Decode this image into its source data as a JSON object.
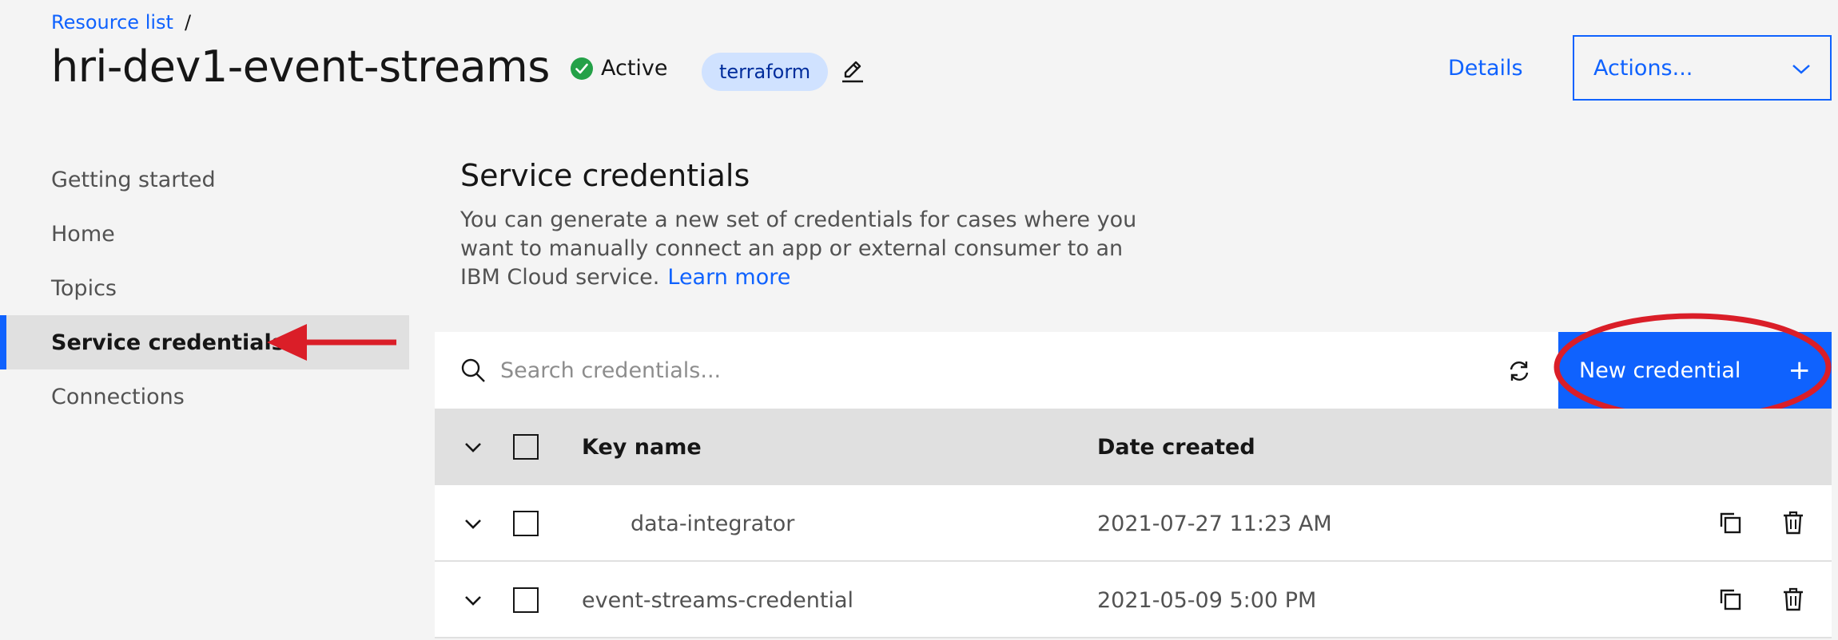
{
  "header": {
    "breadcrumb": {
      "label": "Resource list",
      "separator": "/"
    },
    "title": "hri-dev1-event-streams",
    "status": {
      "label": "Active",
      "color": "#24a148"
    },
    "tag": "terraform",
    "details_label": "Details",
    "actions_label": "Actions..."
  },
  "sidebar": {
    "items": [
      {
        "label": "Getting started"
      },
      {
        "label": "Home"
      },
      {
        "label": "Topics"
      },
      {
        "label": "Service credentials",
        "active": true
      },
      {
        "label": "Connections"
      }
    ]
  },
  "main": {
    "section_title": "Service credentials",
    "section_desc": "You can generate a new set of credentials for cases where you want to manually connect an app or external consumer to an IBM Cloud service.",
    "learn_more": "Learn more",
    "search": {
      "placeholder": "Search credentials..."
    },
    "new_credential_label": "New credential",
    "table": {
      "columns": [
        "Key name",
        "Date created"
      ],
      "rows": [
        {
          "key_name": "data-integrator",
          "date_created": "2021-07-27 11:23 AM"
        },
        {
          "key_name": "event-streams-credential",
          "date_created": "2021-05-09 5:00 PM"
        }
      ]
    }
  },
  "colors": {
    "accent": "#0f62fe",
    "annotation": "#da1e28"
  },
  "icons": [
    "check-icon",
    "edit-pencil-icon",
    "chevron-down-icon",
    "search-icon",
    "refresh-icon",
    "plus-icon",
    "copy-icon",
    "trash-icon",
    "annotation-arrow",
    "annotation-ellipse"
  ]
}
